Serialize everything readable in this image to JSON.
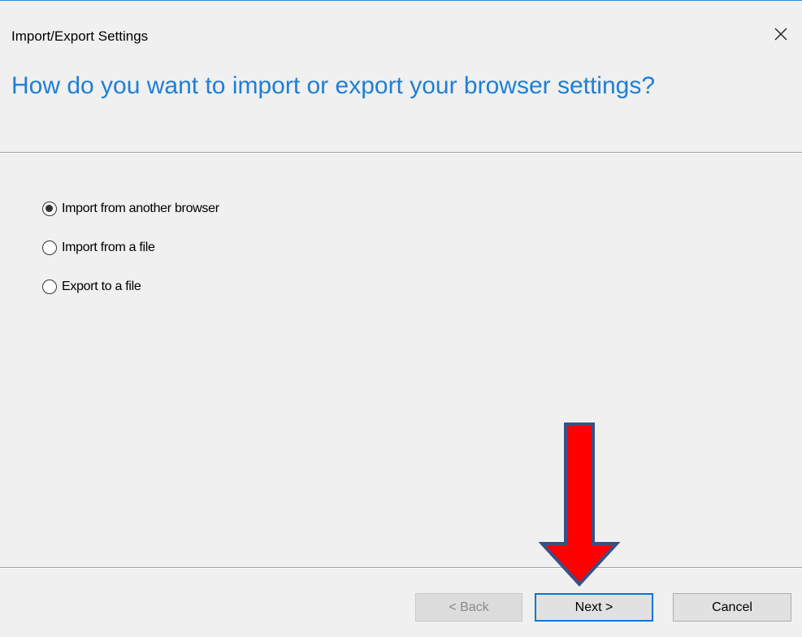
{
  "window": {
    "title": "Import/Export Settings",
    "heading": "How do you want to import or export your browser settings?",
    "close_icon": "close-icon"
  },
  "options": [
    {
      "label": "Import from another browser",
      "checked": true
    },
    {
      "label": "Import from a file",
      "checked": false
    },
    {
      "label": "Export to a file",
      "checked": false
    }
  ],
  "buttons": {
    "back_label": "< Back",
    "back_enabled": false,
    "next_label": "Next >",
    "cancel_label": "Cancel"
  },
  "colors": {
    "heading": "#1e7fd6",
    "arrow_fill": "#ff0000",
    "arrow_outline": "#3a4f86",
    "focus_border": "#0078d7"
  },
  "annotation": {
    "arrow_icon": "down-arrow-icon"
  }
}
